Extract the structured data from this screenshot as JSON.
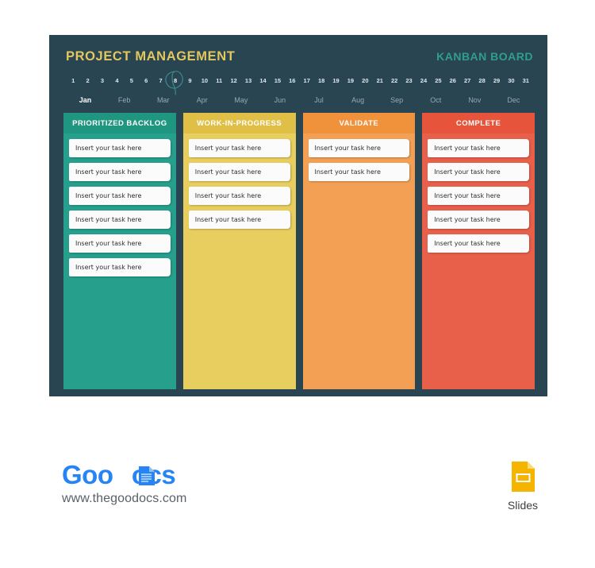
{
  "page": {
    "background": "#ffffff"
  },
  "board": {
    "background": "#294552",
    "title": "PROJECT MANAGEMENT",
    "subtitle": "KANBAN BOARD",
    "title_color": "#E3C75E",
    "subtitle_color": "#2E9F8E",
    "timeline": {
      "days": [
        "1",
        "2",
        "3",
        "4",
        "5",
        "6",
        "7",
        "8",
        "9",
        "10",
        "11",
        "12",
        "13",
        "14",
        "15",
        "16",
        "17",
        "18",
        "19",
        "19",
        "20",
        "21",
        "22",
        "23",
        "24",
        "25",
        "26",
        "27",
        "28",
        "29",
        "30",
        "31"
      ],
      "marked_day": "8",
      "marked_day_index": 7,
      "months": [
        "Jan",
        "Feb",
        "Mar",
        "Apr",
        "May",
        "Jun",
        "Jul",
        "Aug",
        "Sep",
        "Oct",
        "Nov",
        "Dec"
      ],
      "active_month": "Jan",
      "active_month_index": 0
    },
    "columns": [
      {
        "id": "prioritized-backlog",
        "title": "PRIORITIZED BACKLOG",
        "header_color": "#1F9680",
        "body_color": "#26A08C",
        "cards": [
          "Insert your task here",
          "Insert your task here",
          "Insert your task here",
          "Insert your task here",
          "Insert your task here",
          "Insert your task here"
        ]
      },
      {
        "id": "work-in-progress",
        "title": "WORK-IN-PROGRESS",
        "header_color": "#E0BF46",
        "body_color": "#E8CE5F",
        "cards": [
          "Insert your task here",
          "Insert your task here",
          "Insert your task here",
          "Insert your task here"
        ]
      },
      {
        "id": "validate",
        "title": "VALIDATE",
        "header_color": "#F0923C",
        "body_color": "#F3A055",
        "cards": [
          "Insert your task here",
          "Insert your task here"
        ]
      },
      {
        "id": "complete",
        "title": "COMPLETE",
        "header_color": "#E6543B",
        "body_color": "#E8604A",
        "cards": [
          "Insert your task here",
          "Insert your task here",
          "Insert your task here",
          "Insert your task here",
          "Insert your task here"
        ]
      }
    ]
  },
  "footer": {
    "logo_part1": "Goo",
    "logo_part2": "ocs",
    "logo_color": "#2684F5",
    "url": "www.thegoodocs.com",
    "slides_label": "Slides",
    "slides_icon_color": "#F4B400"
  }
}
